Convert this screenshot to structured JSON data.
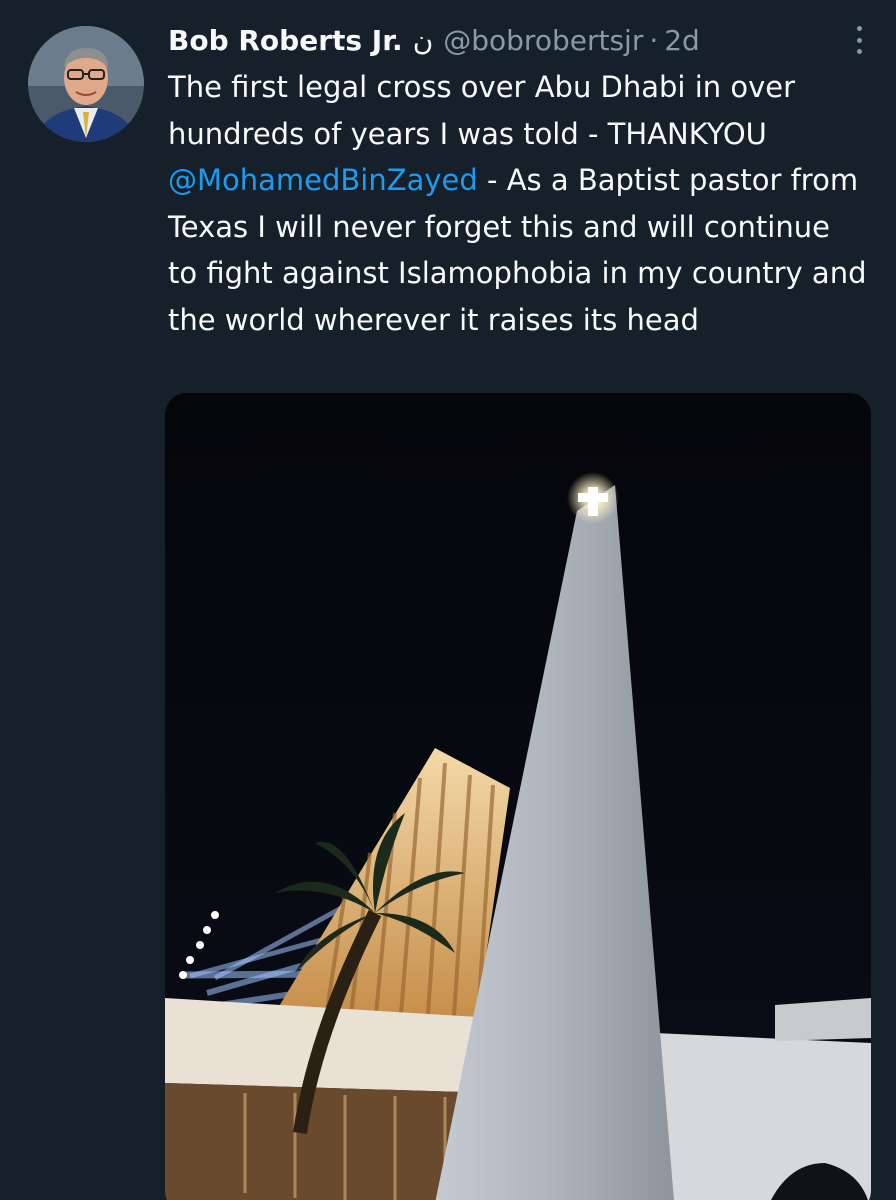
{
  "tweet": {
    "author_name": "Bob Roberts Jr.",
    "author_suffix": "ن",
    "handle": "@bobrobertsjr",
    "separator": "·",
    "timestamp": "2d",
    "text_before_mention": "The first legal cross over Abu Dhabi in over hundreds of years I was told - THANKYOU ",
    "mention": "@MohamedBinZayed",
    "text_after_mention": " - As a Baptist pastor from Texas I will never forget this and will continue to fight against Islamophobia in my country and the world wherever it raises its head"
  },
  "icons": {
    "more": "more-options-icon"
  },
  "colors": {
    "background": "#15202b",
    "text": "#f7f9f9",
    "secondary": "#8b98a5",
    "link": "#1d9bf0"
  }
}
